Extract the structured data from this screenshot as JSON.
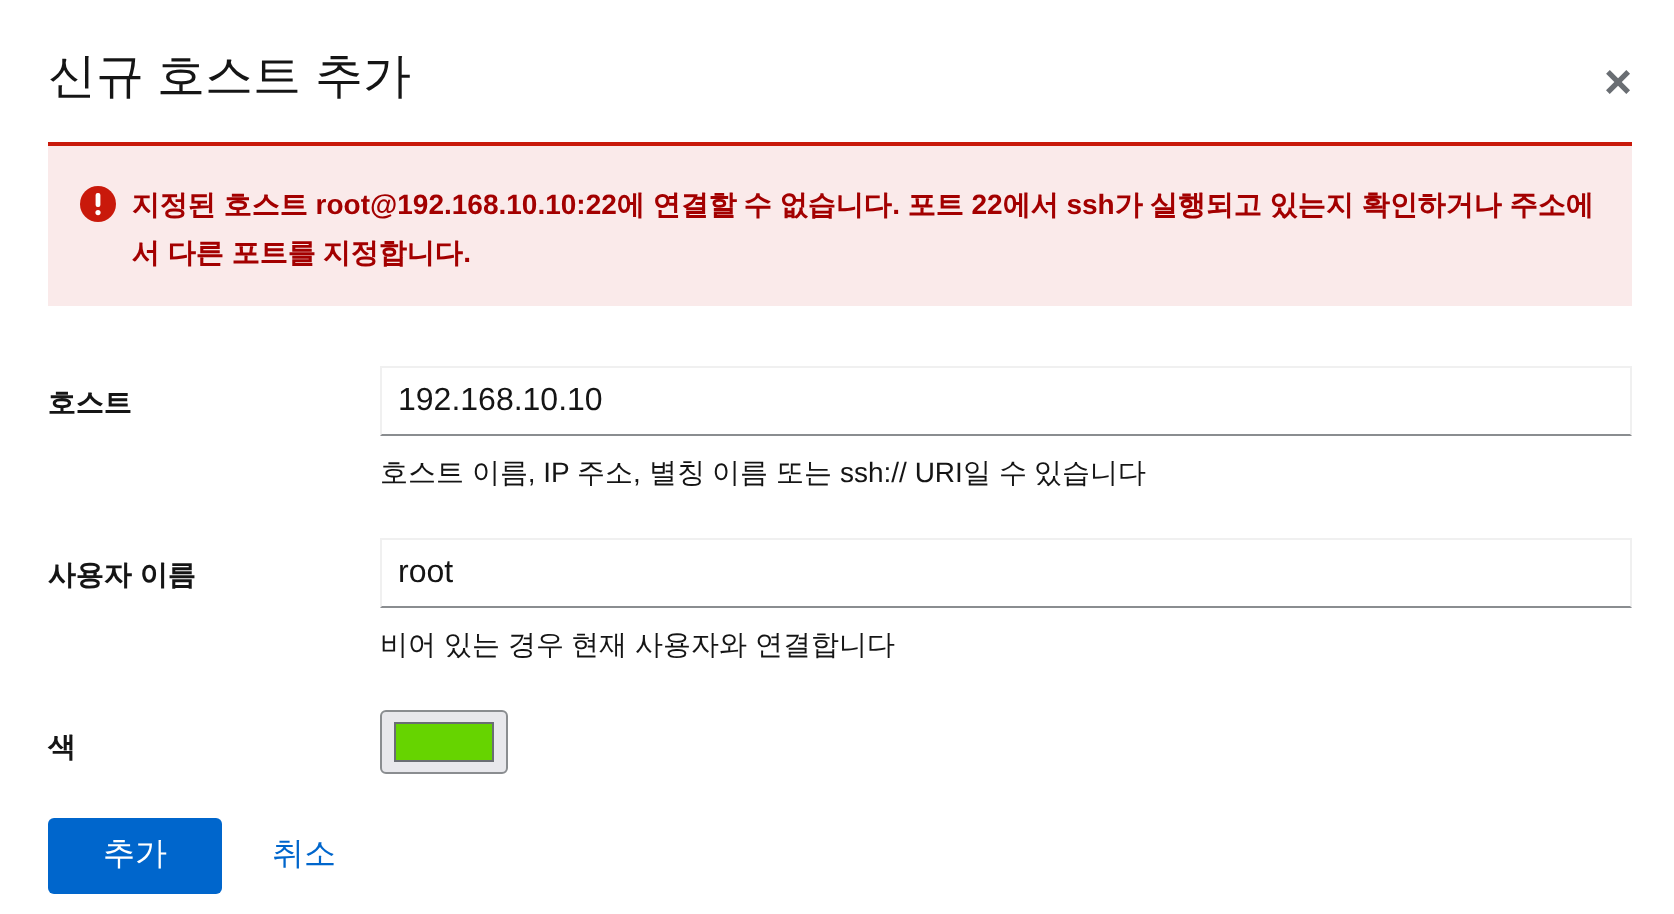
{
  "dialog": {
    "title": "신규 호스트 추가",
    "close": "×"
  },
  "alert": {
    "kind": "danger",
    "text": "지정된 호스트 root@192.168.10.10:22에 연결할 수 없습니다. 포트 22에서 ssh가 실행되고 있는지 확인하거나 주소에서 다른 포트를 지정합니다."
  },
  "fields": [
    {
      "kind": "text",
      "label": "호스트",
      "value": "192.168.10.10",
      "help": "호스트 이름, IP 주소, 별칭 이름 또는 ssh:// URI일 수 있습니다"
    },
    {
      "kind": "text",
      "label": "사용자 이름",
      "value": "root",
      "help": "비어 있는 경우 현재 사용자와 연결합니다"
    },
    {
      "kind": "color",
      "label": "색",
      "color": "#66d400"
    }
  ],
  "buttons": [
    {
      "kind": "primary",
      "label": "추가"
    },
    {
      "kind": "link",
      "label": "취소"
    }
  ]
}
